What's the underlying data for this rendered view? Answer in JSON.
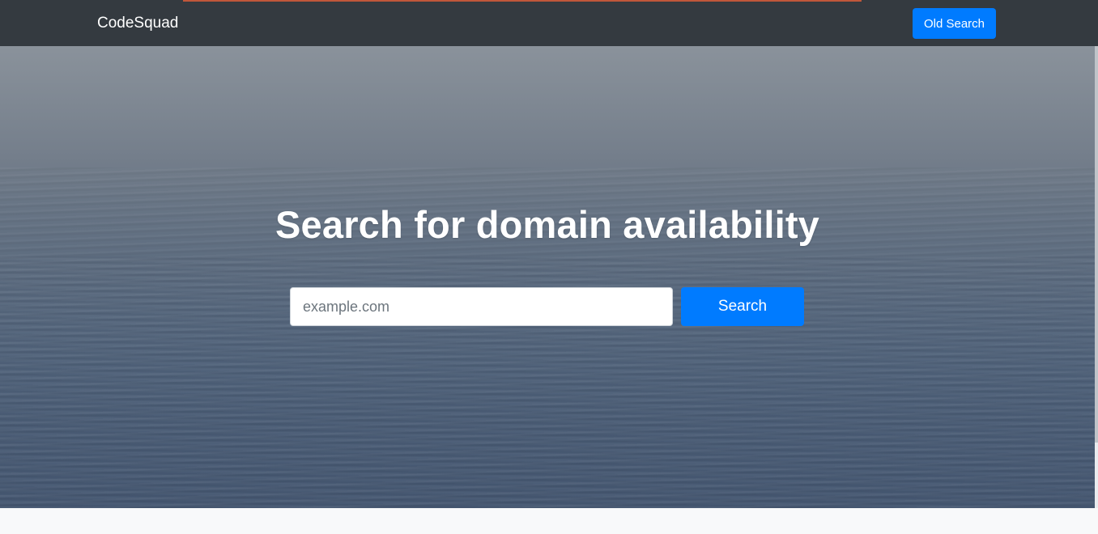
{
  "navbar": {
    "brand": "CodeSquad",
    "old_search_label": "Old Search"
  },
  "hero": {
    "title": "Search for domain availability",
    "search_input": {
      "placeholder": "example.com",
      "value": ""
    },
    "search_button_label": "Search"
  },
  "colors": {
    "navbar_bg": "#343a40",
    "primary": "#007bff",
    "text_light": "#ffffff"
  }
}
